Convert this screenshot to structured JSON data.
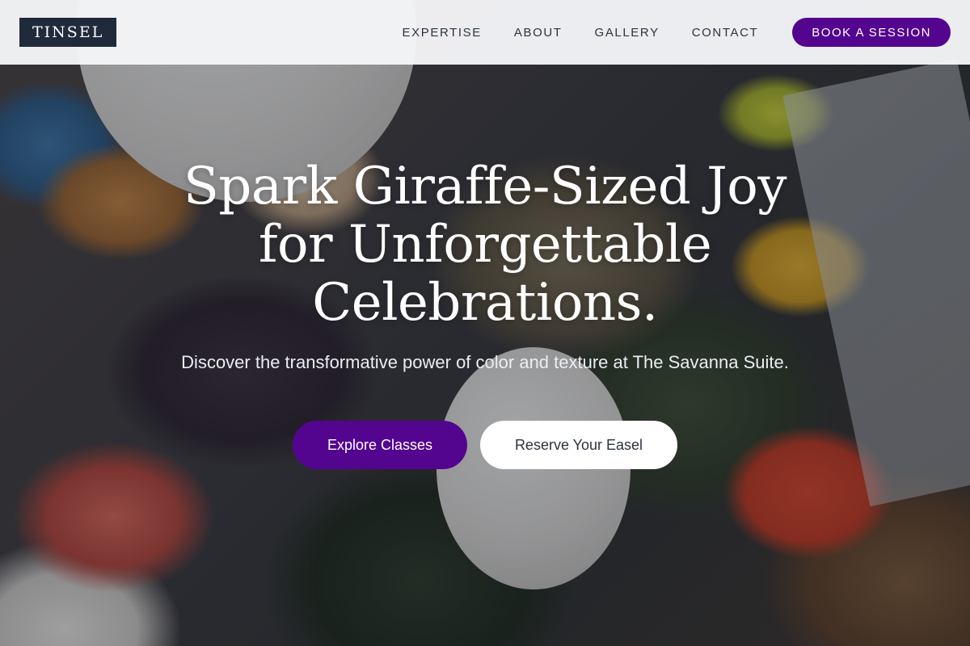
{
  "header": {
    "logo_text": "TINSEL",
    "nav": [
      {
        "label": "EXPERTISE"
      },
      {
        "label": "ABOUT"
      },
      {
        "label": "GALLERY"
      },
      {
        "label": "CONTACT"
      }
    ],
    "cta_label": "BOOK A SESSION"
  },
  "hero": {
    "title": "Spark Giraffe-Sized Joy for Unforgettable Celebrations.",
    "subtitle": "Discover the transformative power of color and texture at The Savanna Suite.",
    "primary_button": "Explore Classes",
    "secondary_button": "Reserve Your Easel"
  },
  "colors": {
    "accent": "#54058f",
    "logo_bg": "#1f2a3b",
    "header_bg": "#f5f6f8",
    "nav_text": "#2b3340"
  }
}
